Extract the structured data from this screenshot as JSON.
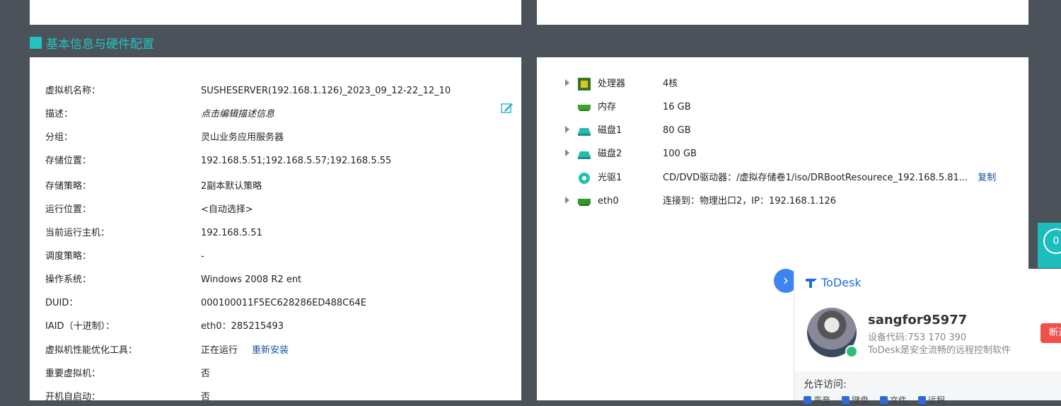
{
  "section_title": "基本信息与硬件配置",
  "basic_info": [
    {
      "label": "虚拟机名称：",
      "value": "SUSHESERVER(192.168.1.126)_2023_09_12-22_12_10"
    },
    {
      "label": "描述：",
      "value": "点击编辑描述信息"
    },
    {
      "label": "分组：",
      "value": "灵山业务应用服务器"
    },
    {
      "label": "存储位置：",
      "value": "192.168.5.51;192.168.5.57;192.168.5.55"
    },
    {
      "label": "存储策略：",
      "value": "2副本默认策略"
    },
    {
      "label": "运行位置：",
      "value": "<自动选择>"
    },
    {
      "label": "当前运行主机：",
      "value": "192.168.5.51"
    },
    {
      "label": "调度策略：",
      "value": "-"
    },
    {
      "label": "操作系统：",
      "value": "Windows 2008 R2 ent"
    },
    {
      "label": "DUID：",
      "value": "000100011F5EC628286ED488C64E"
    },
    {
      "label": "IAID（十进制）：",
      "value": "eth0：285215493"
    },
    {
      "label": "虚拟机性能优化工具：",
      "value": "正在运行",
      "link": "重新安装"
    },
    {
      "label": "重要虚拟机：",
      "value": "否"
    },
    {
      "label": "开机自启动：",
      "value": "否"
    }
  ],
  "hardware": [
    {
      "name": "处理器",
      "value": "4核",
      "icon": "cpu-icon",
      "expandable": true
    },
    {
      "name": "内存",
      "value": "16 GB",
      "icon": "memory-icon",
      "expandable": false
    },
    {
      "name": "磁盘1",
      "value": "80 GB",
      "icon": "disk-icon",
      "expandable": true
    },
    {
      "name": "磁盘2",
      "value": "100 GB",
      "icon": "disk-icon",
      "expandable": true
    },
    {
      "name": "光驱1",
      "value": "CD/DVD驱动器：/虚拟存储卷1/iso/DRBootResourece_192.168.5.81...",
      "link": "复制",
      "icon": "cdrom-icon",
      "expandable": false
    },
    {
      "name": "eth0",
      "value": "连接到：物理出口2，IP：192.168.1.126",
      "icon": "nic-icon",
      "expandable": true
    }
  ],
  "side_tab": {
    "label": "0"
  },
  "todesk": {
    "brand": "ToDesk",
    "username": "sangfor95977",
    "device_code": "设备代码:753 170 390",
    "slogan": "ToDesk是安全流畅的远程控制软件",
    "disconnect": "断开",
    "allow_label": "允许访问:",
    "permissions": [
      "声音",
      "键盘",
      "文件",
      "远程"
    ]
  },
  "colors": {
    "accent": "#22c3c3",
    "background": "#4c5259",
    "link": "#1a4ea8",
    "todesk_blue": "#1f6bd8"
  }
}
